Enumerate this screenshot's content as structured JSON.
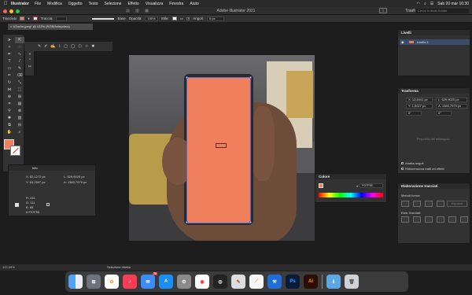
{
  "menubar": {
    "app": "Illustrator",
    "items": [
      "File",
      "Modifica",
      "Oggetto",
      "Testo",
      "Selezione",
      "Effetto",
      "Visualizza",
      "Finestra",
      "Aiuto"
    ],
    "clock": "Sab 20 mar 16:30"
  },
  "titlebar": {
    "title": "Adobe Illustrator 2021",
    "workspace": "Trasforma",
    "search_placeholder": "Cerca in Aiuto Adobe"
  },
  "controlbar": {
    "label": "Tracciato",
    "fill_color": "#f07f5d",
    "stroke_label": "Traccia:",
    "stroke_style": "Base",
    "opacity_label": "Opacità:",
    "opacity_value": "100%",
    "style_label": "Stile:",
    "angle_label": "Angoli:",
    "angle_value": "0 px"
  },
  "document": {
    "tab": "U2uzhn.jpeg* @ 122% (RGB/Anteprima)"
  },
  "info_panel": {
    "title": "Info",
    "x": "X: 62,1272 px",
    "y": "Y: 63,2597 px",
    "w": "L: 629,9025 px",
    "h": "A: 1360,7979 px",
    "r": "R: 241",
    "g": "G: 111",
    "b": "B: 85",
    "hex": "# F07F55"
  },
  "layers_panel": {
    "title": "Livelli",
    "layer_name": "Livello 1"
  },
  "transform_panel": {
    "title": "Trasforma",
    "x_value": "X: 12,8441 px",
    "y_value": "Y: 1,5027 px",
    "w_value": "L: 629,9025 px",
    "h_value": "A: 1360,7979 px",
    "angle": "0°",
    "shear": "0°",
    "muted_text": "Proprietà del rettangolo",
    "scale_corners": "Adatta angoli",
    "scale_strokes": "Ridimensiona tratti ed effetti"
  },
  "pathfinder_panel": {
    "title": "Elaborazione tracciati",
    "shape_modes": "Metodi forma:",
    "expand_button": "Espandi",
    "pathfinders": "Elab. tracciati:"
  },
  "color_panel": {
    "title": "Colore",
    "hex_label": "#",
    "hex_value": "F07F55"
  },
  "statusbar": {
    "zoom": "122.05%",
    "tool": "Selezione diretta"
  },
  "dock": {
    "mail_badge": "78",
    "apps": [
      "Finder",
      "Launchpad",
      "Foto",
      "Musica",
      "Mail",
      "App Store",
      "Preferenze",
      "Chrome",
      "GitHub",
      "Anteprima",
      "Pages",
      "Xcode",
      "Photoshop",
      "Illustrator",
      "Download",
      "Cestino"
    ],
    "ps_label": "Ps",
    "ai_label": "Ai"
  }
}
